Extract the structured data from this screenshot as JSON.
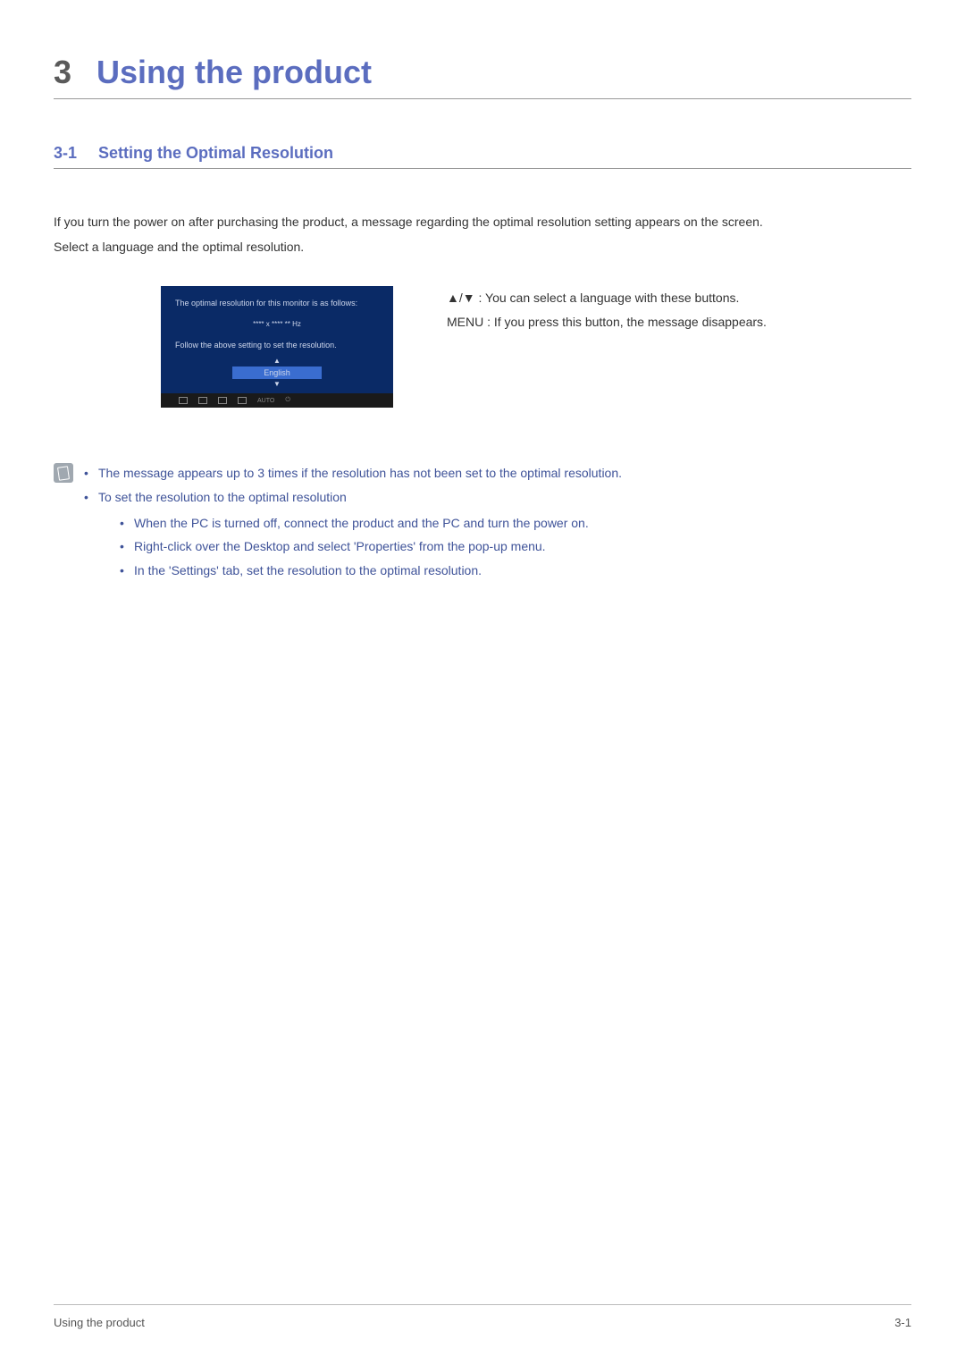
{
  "chapter": {
    "number": "3",
    "title": "Using the product"
  },
  "section": {
    "number": "3-1",
    "title": "Setting the Optimal Resolution"
  },
  "intro": {
    "line1": "If you turn the power on after purchasing the product, a message regarding the optimal resolution setting appears on the screen.",
    "line2": "Select a language and the optimal resolution."
  },
  "osd": {
    "line1": "The optimal resolution for this monitor is as follows:",
    "resolution": "**** x **** ** Hz",
    "line2": "Follow the above setting to set the resolution.",
    "language": "English"
  },
  "side": {
    "row1": "▲/▼ : You can select a language with these buttons.",
    "row2": "MENU : If you press this button, the message disappears."
  },
  "note": {
    "item1": "The message appears up to 3 times if the resolution has not been set to the optimal resolution.",
    "item2": "To set the resolution to the optimal resolution",
    "sub1": "When the PC is turned off, connect the product and the PC and turn the power on.",
    "sub2": "Right-click over the Desktop and select 'Properties' from the pop-up menu.",
    "sub3": "In the 'Settings' tab, set the resolution to the optimal resolution."
  },
  "footer": {
    "left": "Using the product",
    "right": "3-1"
  }
}
